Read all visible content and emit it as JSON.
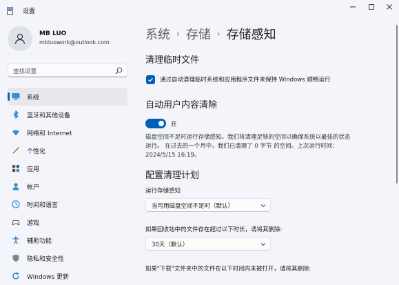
{
  "window": {
    "title": "设置",
    "controls": [
      "minimize",
      "maximize",
      "close"
    ]
  },
  "user": {
    "name": "MB LUO",
    "email": "mbluowork@outlook.com"
  },
  "search": {
    "placeholder": "查找设置"
  },
  "sidebar": {
    "items": [
      {
        "label": "系统",
        "icon": "system-icon",
        "active": true
      },
      {
        "label": "蓝牙和其他设备",
        "icon": "bluetooth-icon"
      },
      {
        "label": "网络和 Internet",
        "icon": "wifi-icon"
      },
      {
        "label": "个性化",
        "icon": "brush-icon"
      },
      {
        "label": "应用",
        "icon": "apps-icon"
      },
      {
        "label": "帐户",
        "icon": "account-icon"
      },
      {
        "label": "时间和语言",
        "icon": "globe-clock-icon"
      },
      {
        "label": "游戏",
        "icon": "gamepad-icon"
      },
      {
        "label": "辅助功能",
        "icon": "accessibility-icon"
      },
      {
        "label": "隐私和安全性",
        "icon": "shield-icon"
      },
      {
        "label": "Windows 更新",
        "icon": "update-icon"
      }
    ]
  },
  "breadcrumb": {
    "items": [
      "系统",
      "存储",
      "存储感知"
    ],
    "separator": "›"
  },
  "content": {
    "cleanup_temp": {
      "heading": "清理临时文件",
      "checkbox_label": "通过自动清理临时系统和应用程序文件来保持 Windows 顺畅运行",
      "checked": true
    },
    "auto_cleanup": {
      "heading": "自动用户内容清除",
      "toggle_label": "开",
      "toggle_on": true,
      "description": "磁盘空间不足时运行存储感知。我们将清理足够的空间以确保系统以最佳的状态运行。 在过去的一个月中，我们已清理了 0 字节 的空间。上次运行时间：2024/5/15 16:19。"
    },
    "schedule": {
      "heading": "配置清理计划",
      "run_label": "运行存储感知",
      "run_value": "当可用磁盘空间不足时（默认）",
      "recycle_label": "如果回收站中的文件存在超过以下时长，请将其删除:",
      "recycle_value": "30天（默认）",
      "downloads_label": "如果\"下载\"文件夹中的文件在以下时间内未被打开，请将其删除:"
    }
  },
  "colors": {
    "accent": "#005fb8",
    "background": "#f3f5fa",
    "nav_active": "#e6e8ee"
  }
}
